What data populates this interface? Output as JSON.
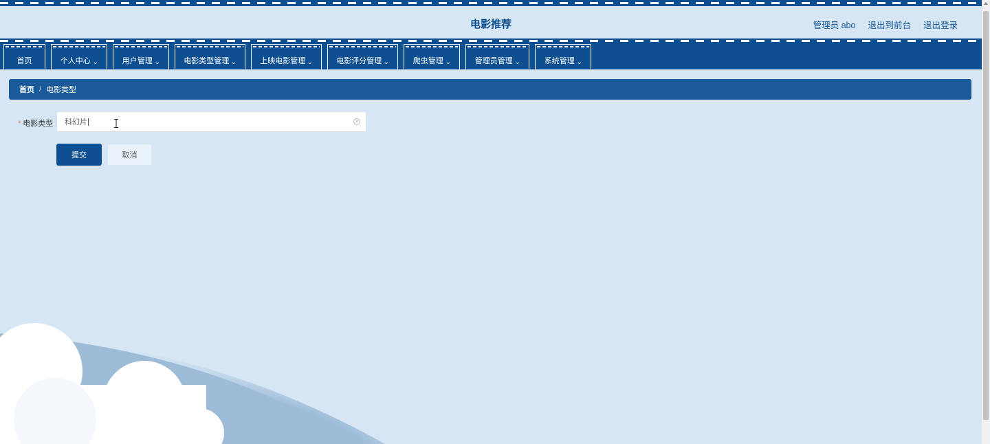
{
  "header": {
    "title": "电影推荐",
    "admin_label": "管理员 abo",
    "to_frontend": "退出到前台",
    "logout": "退出登录"
  },
  "nav": {
    "items": [
      {
        "label": "首页",
        "dropdown": false
      },
      {
        "label": "个人中心",
        "dropdown": true
      },
      {
        "label": "用户管理",
        "dropdown": true
      },
      {
        "label": "电影类型管理",
        "dropdown": true
      },
      {
        "label": "上映电影管理",
        "dropdown": true
      },
      {
        "label": "电影评分管理",
        "dropdown": true
      },
      {
        "label": "爬虫管理",
        "dropdown": true
      },
      {
        "label": "管理员管理",
        "dropdown": true
      },
      {
        "label": "系统管理",
        "dropdown": true
      }
    ]
  },
  "breadcrumb": {
    "home": "首页",
    "separator": "/",
    "current": "电影类型"
  },
  "form": {
    "required_mark": "*",
    "label": "电影类型",
    "value": "科幻片",
    "submit": "提交",
    "cancel": "取消"
  },
  "colors": {
    "primary": "#0d4f91",
    "breadcrumb_bg": "#1b5a9a",
    "page_bg": "#d6e6f4"
  }
}
